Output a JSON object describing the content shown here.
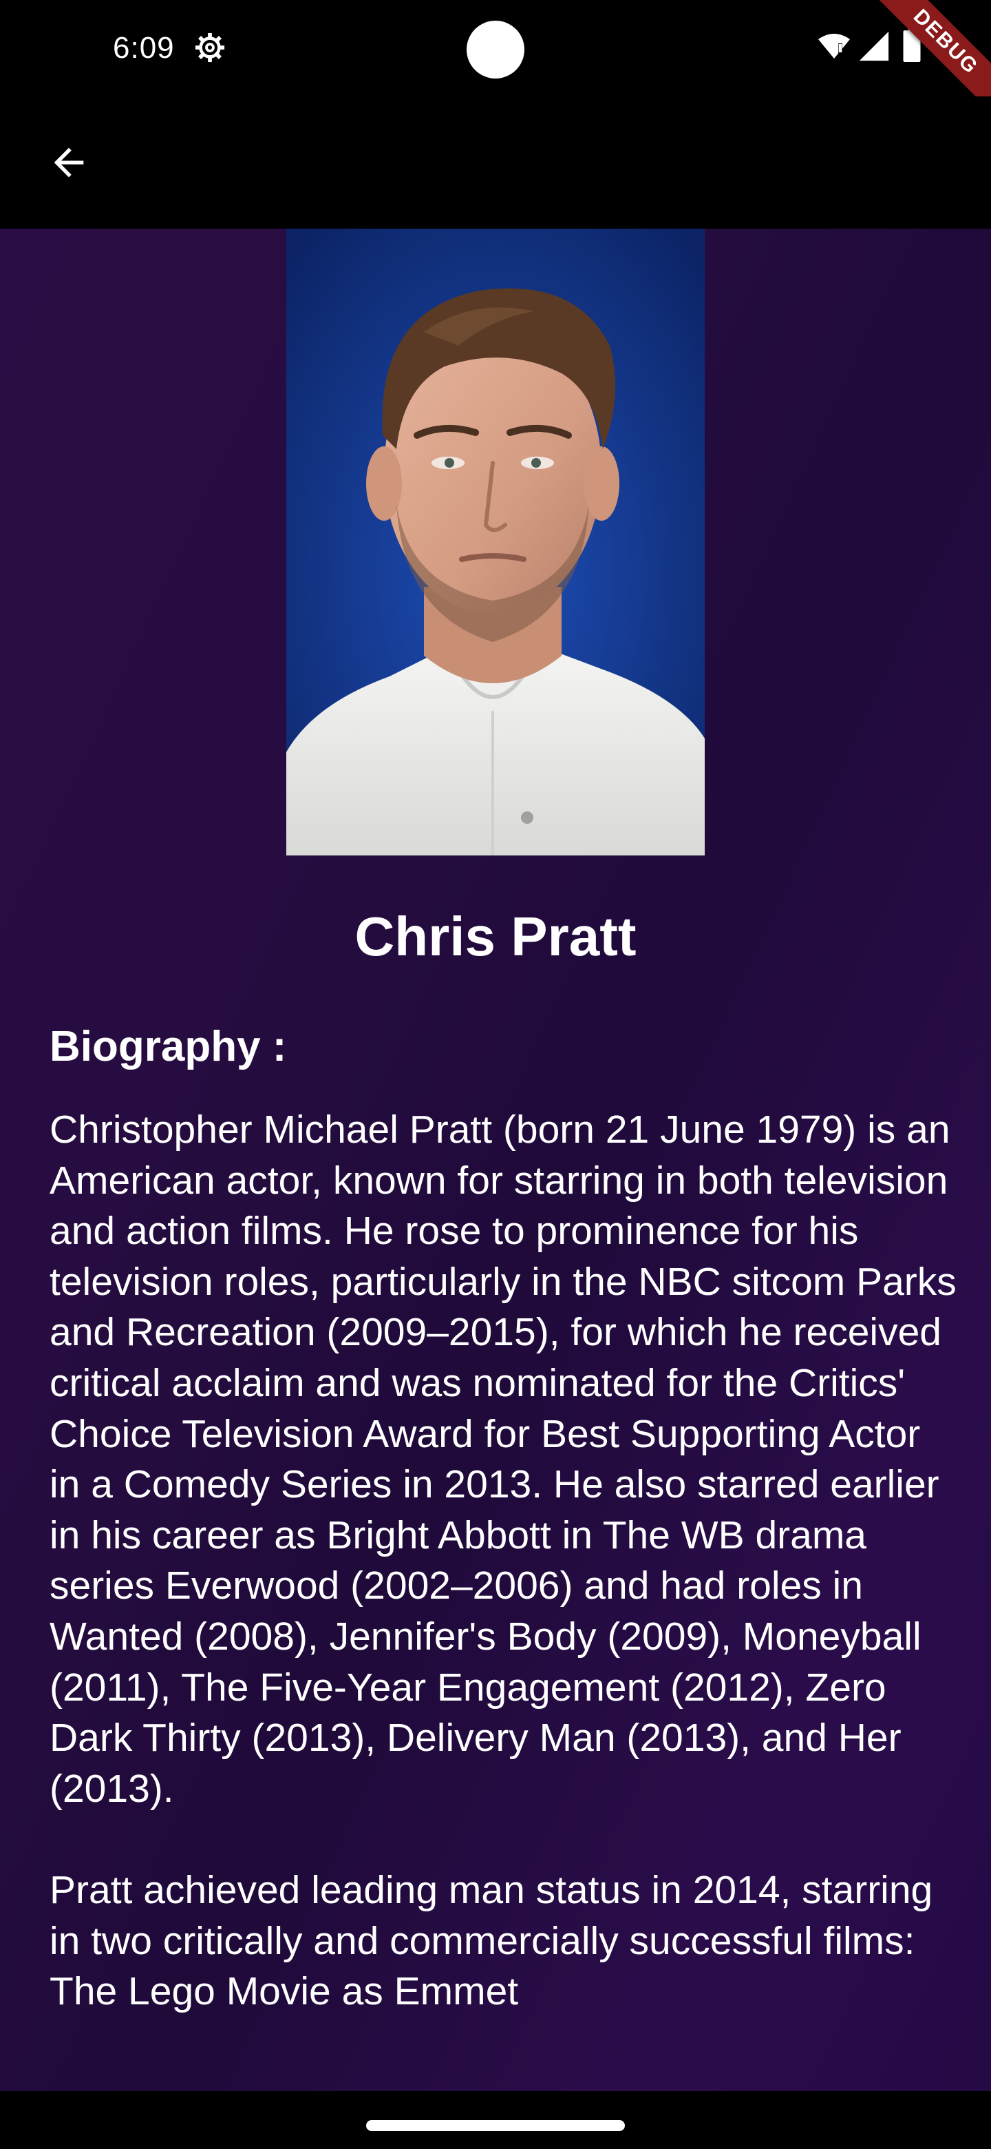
{
  "status_bar": {
    "time": "6:09",
    "icons": [
      "settings-gear-icon",
      "wifi-icon",
      "cellular-signal-icon",
      "battery-icon"
    ]
  },
  "debug_banner": "DEBUG",
  "app_bar": {
    "back_icon": "arrow-back-icon"
  },
  "actor": {
    "name": "Chris Pratt",
    "biography_label": "Biography :",
    "biography": "Christopher Michael Pratt (born 21 June 1979) is an American actor, known for starring in both television and action films. He rose to prominence for his television roles, particularly in the NBC sitcom Parks and Recreation (2009–2015), for which he received critical acclaim and was nominated for the Critics' Choice Television Award for Best Supporting Actor in a Comedy Series in 2013. He also starred earlier in his career as Bright Abbott in The WB drama series Everwood (2002–2006) and had roles in Wanted (2008), Jennifer's Body (2009), Moneyball (2011), The Five-Year Engagement (2012), Zero Dark Thirty (2013), Delivery Man (2013), and Her (2013).\n\nPratt achieved leading man status in 2014, starring in two critically and commercially successful films: The Lego Movie as Emmet"
  },
  "colors": {
    "background_gradient_start": "#2a0d44",
    "background_gradient_end": "#250a46",
    "photo_background": "#0e2f8a",
    "text": "#ffffff",
    "debug_banner": "#8b1a1a"
  }
}
